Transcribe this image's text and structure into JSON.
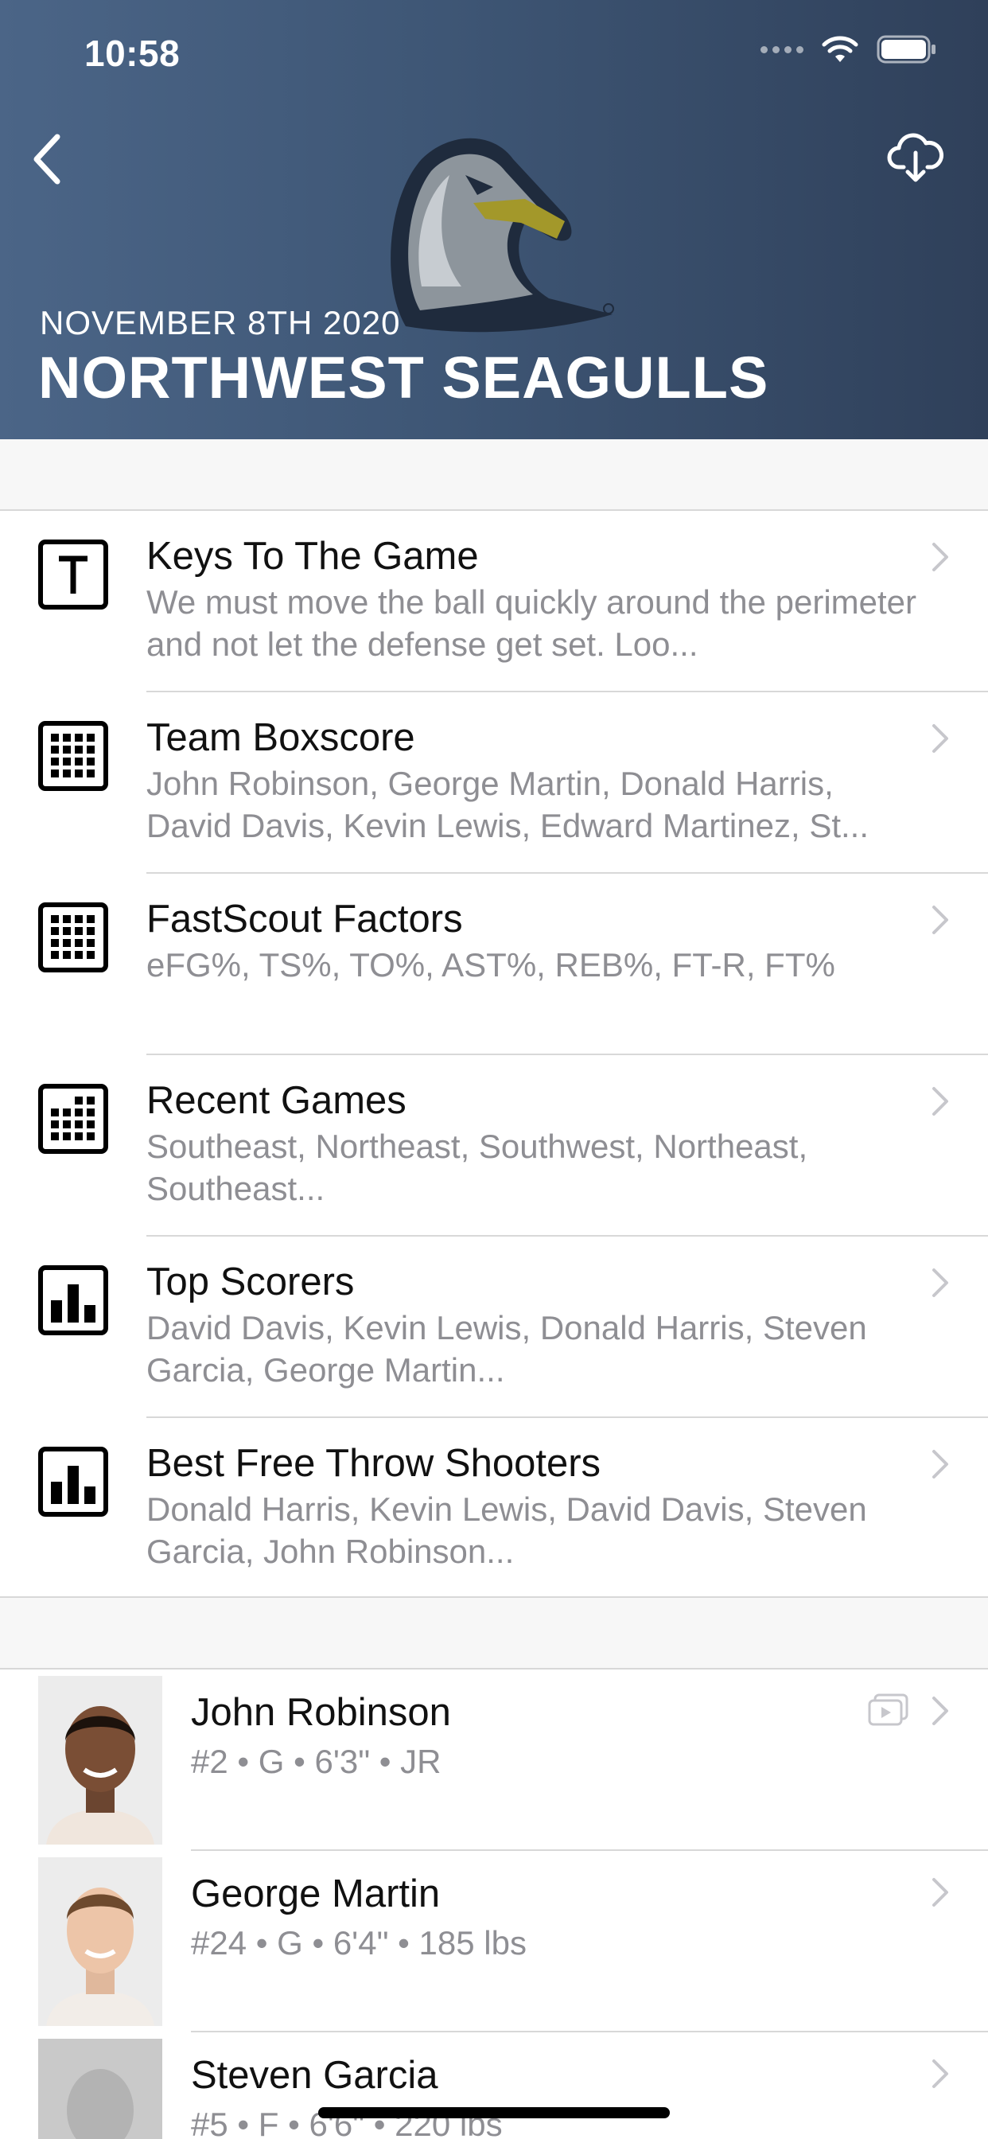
{
  "status_bar": {
    "time": "10:58"
  },
  "header": {
    "date": "NOVEMBER 8TH 2020",
    "team": "NORTHWEST SEAGULLS"
  },
  "menu": [
    {
      "icon": "text-t-icon",
      "title": "Keys To The Game",
      "subtitle": "We must move the ball quickly around the perimeter and not let the defense get set. Loo..."
    },
    {
      "icon": "grid-icon",
      "title": "Team Boxscore",
      "subtitle": "John Robinson, George Martin, Donald Harris, David Davis, Kevin Lewis, Edward Martinez, St..."
    },
    {
      "icon": "grid-icon",
      "title": "FastScout Factors",
      "subtitle": "eFG%, TS%, TO%, AST%, REB%, FT-R, FT%"
    },
    {
      "icon": "grid-partial-icon",
      "title": "Recent Games",
      "subtitle": "Southeast, Northeast, Southwest, Northeast, Southeast..."
    },
    {
      "icon": "bar-chart-icon",
      "title": "Top Scorers",
      "subtitle": "David Davis, Kevin Lewis, Donald Harris, Steven Garcia, George Martin..."
    },
    {
      "icon": "bar-chart-icon",
      "title": "Best Free Throw Shooters",
      "subtitle": "Donald Harris, Kevin Lewis, David Davis, Steven Garcia, John Robinson..."
    }
  ],
  "players": [
    {
      "name": "John Robinson",
      "detail": "#2 • G • 6'3\" • JR",
      "has_video": true
    },
    {
      "name": "George Martin",
      "detail": "#24 • G • 6'4\" • 185 lbs",
      "has_video": false
    },
    {
      "name": "Steven Garcia",
      "detail": "#5 • F • 6'6\" • 220 lbs",
      "has_video": false
    }
  ],
  "colors": {
    "header_start": "#4b6587",
    "header_end": "#2f405a",
    "secondary_text": "#8e8e93",
    "separator": "#d8d8d8"
  }
}
